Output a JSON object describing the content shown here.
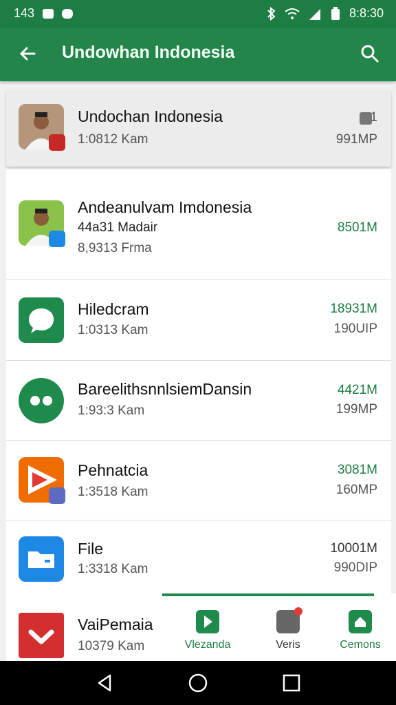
{
  "status_bar": {
    "time": "143",
    "clock": "8:8:30",
    "notification_icons": [
      "image-icon",
      "game-icon"
    ],
    "system_icons": [
      "bluetooth-icon",
      "wifi-icon",
      "signal-icon",
      "battery-icon"
    ]
  },
  "app_bar": {
    "title": "Undowhan Indonesia",
    "back_icon": "arrow-back-icon",
    "search_icon": "search-icon"
  },
  "apps": [
    {
      "name": "Undochan Indonesia",
      "sub": "1:0812 Kam",
      "sub2": "",
      "size": "1",
      "size2": "991MP",
      "icon": "portrait-icon",
      "highlight": true
    },
    {
      "name": "Andeanulvam Imdonesia",
      "sub": "44a31 Madair",
      "sub2": "8,9313 Frma",
      "size": "8501M",
      "size2": "",
      "icon": "portrait-icon"
    },
    {
      "name": "Hiledcram",
      "sub": "1:0313 Kam",
      "sub2": "",
      "size": "18931M",
      "size2": "190UIP",
      "icon": "chat-bubble-icon"
    },
    {
      "name": "BareelithsnnlsiemDansin",
      "sub": "1:93:3 Kam",
      "sub2": "",
      "size": "4421M",
      "size2": "199MP",
      "icon": "dots-icon"
    },
    {
      "name": "Pehnatcia",
      "sub": "1:3518 Kam",
      "sub2": "",
      "size": "3081M",
      "size2": "160MP",
      "icon": "play-icon"
    },
    {
      "name": "File",
      "sub": "1:3318 Kam",
      "sub2": "",
      "size": "10001M",
      "size2": "990DIP",
      "icon": "folder-icon"
    },
    {
      "name": "VaiPemaia",
      "sub": "10379 Kam",
      "sub2": "",
      "size": "",
      "size2": "",
      "icon": "check-icon"
    }
  ],
  "bottom_nav": [
    {
      "label": "Vlezanda",
      "icon": "flag-icon",
      "active": true
    },
    {
      "label": "Veris",
      "icon": "screen-icon",
      "active": false
    },
    {
      "label": "Cemons",
      "icon": "home-icon",
      "active": false
    }
  ],
  "colors": {
    "primary": "#23854a",
    "status": "#1e7d43",
    "accent_text": "#1e7d43"
  }
}
